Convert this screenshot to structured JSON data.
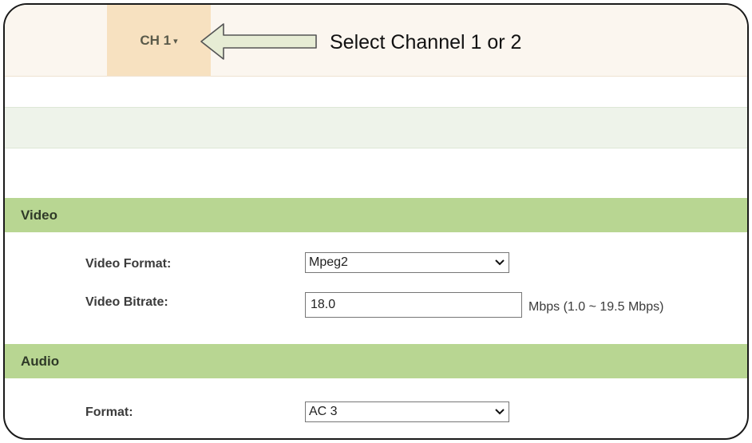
{
  "header": {
    "channel_label": "CH 1",
    "channel_caret": "▾"
  },
  "annotation": {
    "text": "Select Channel 1 or 2"
  },
  "video": {
    "title": "Video",
    "format_label": "Video Format:",
    "format_value": "Mpeg2",
    "bitrate_label": "Video Bitrate:",
    "bitrate_value": "18.0",
    "bitrate_unit": "Mbps (1.0 ~ 19.5 Mbps)"
  },
  "audio": {
    "title": "Audio",
    "format_label": "Format:",
    "format_value": "AC 3"
  },
  "colors": {
    "section_header": "#b8d692",
    "channel_tab": "#f7e1c0",
    "topbar": "#fbf6ef"
  }
}
